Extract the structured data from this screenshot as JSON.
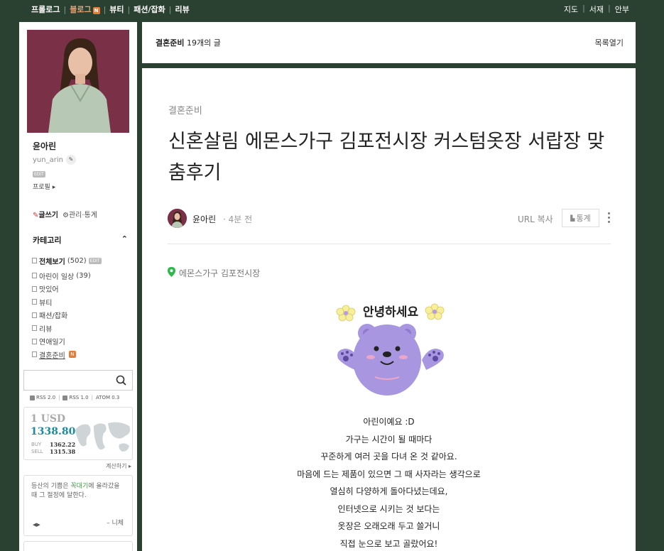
{
  "topnav": {
    "left_items": [
      "프롤로그",
      "블로그",
      "뷰티",
      "패션/잡화",
      "리뷰"
    ],
    "active_item": "블로그",
    "new_badge": "N",
    "right_items": [
      "지도",
      "서재",
      "안부"
    ]
  },
  "sidebar": {
    "profile": {
      "name": "윤아린",
      "id": "yun_arin",
      "edit_badge": "EDIT",
      "profile_link": "프로필"
    },
    "write": "글쓰기",
    "manage": "관리·통계",
    "category_title": "카테고리",
    "categories": [
      {
        "label": "전체보기",
        "count": "(502)",
        "badge": "EDIT"
      },
      {
        "label": "아린이 일상",
        "count": "(39)"
      },
      {
        "label": "맛있어"
      },
      {
        "label": "뷰티"
      },
      {
        "label": "패션/잡화"
      },
      {
        "label": "리뷰"
      },
      {
        "label": "연애일기"
      },
      {
        "label": "결혼준비",
        "badge": "N"
      }
    ],
    "search": {
      "placeholder": ""
    },
    "rss": [
      "RSS 2.0",
      "RSS 1.0",
      "ATOM 0.3"
    ],
    "currency": {
      "unit": "1 USD",
      "rate": "1338.80",
      "buy_label": "BUY",
      "sell_label": "SELL",
      "buy": "1362.22",
      "sell": "1315.38"
    },
    "calc_link": "계산하기",
    "quote": {
      "text_before": "등산의 기쁨은 ",
      "highlight": "꼭대기",
      "text_after": "에 올라갔을 때 그 절정에 달한다.",
      "author": "– 니체"
    }
  },
  "catbar": {
    "category": "결혼준비",
    "count_text": "19개의 글",
    "open_list": "목록열기"
  },
  "article": {
    "category": "결혼준비",
    "title": "신혼살림 에몬스가구 김포전시장 커스텀옷장 서랍장 맞춤후기",
    "author": "윤아린",
    "time": "· 4분 전",
    "url_copy": "URL 복사",
    "stats": "통계",
    "place": "에몬스가구 김포전시장",
    "sticker_text": "안녕하세요",
    "paragraphs": [
      "아린이예요 :D",
      "가구는 시간이 될 때마다",
      "꾸준하게 여러 곳을 다녀 온 것 같아요.",
      "마음에 드는 제품이 있으면 그 때 사자라는 생각으로",
      "열심히 다양하게 돌아다녔는데요,",
      "인터넷으로 시키는 것 보다는",
      "옷장은 오래오래 두고 쓸거니",
      "직접 눈으로 보고 골랐어요!"
    ]
  },
  "colors": {
    "background": "#2a4030",
    "accent_orange": "#e97c35",
    "rate_blue": "#1e8a9e",
    "pin_green": "#2db84c",
    "sticker_purple": "#a897e0"
  }
}
